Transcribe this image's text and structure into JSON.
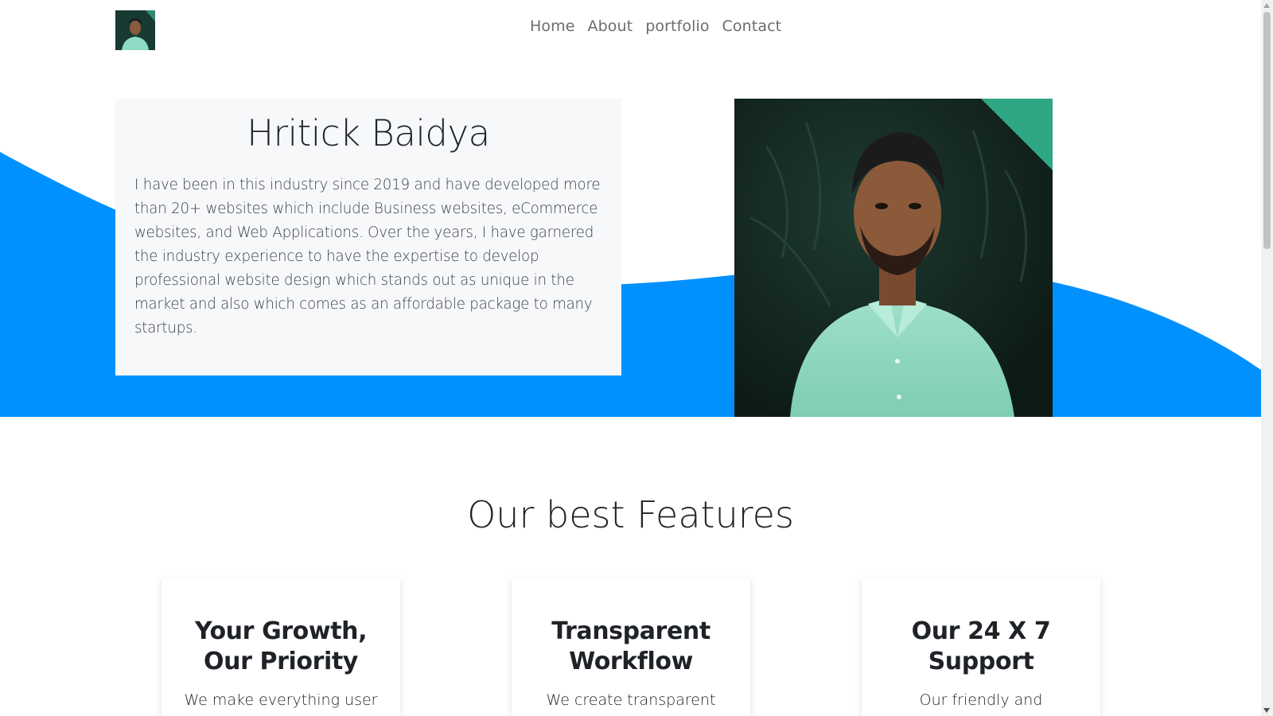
{
  "header": {
    "logo_alt": "Hritick Baidya",
    "nav": [
      {
        "label": "Home"
      },
      {
        "label": "About"
      },
      {
        "label": "portfolio"
      },
      {
        "label": "Contact"
      }
    ]
  },
  "hero": {
    "name": "Hritick Baidya",
    "bio": "I have been in this industry since 2019 and have developed more than 20+ websites which include Business websites, eCommerce websites, and Web Applications. Over the years, I have garnered the industry experience to have the expertise to develop professional website design which stands out as unique in the market and also which comes as an affordable package to many startups.",
    "photo_alt": "Hritick Baidya"
  },
  "features": {
    "title": "Our best Features",
    "cards": [
      {
        "title": "Your Growth, Our Priority",
        "text": "We make everything user"
      },
      {
        "title": "Transparent Workflow",
        "text": "We create transparent"
      },
      {
        "title": "Our 24 X 7 Support",
        "text": "Our friendly and"
      }
    ]
  },
  "colors": {
    "wave": "#0091ff",
    "card_bg": "#f7f8fa",
    "nav_text": "#6c6c6c"
  }
}
